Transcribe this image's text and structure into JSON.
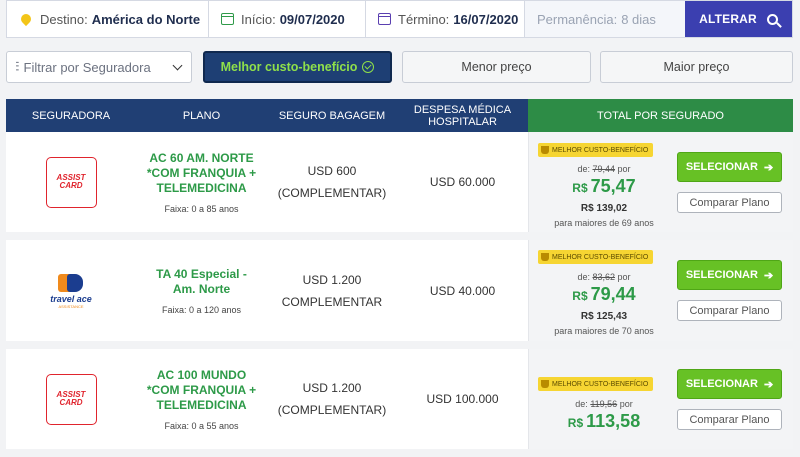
{
  "search": {
    "destino_label": "Destino:",
    "destino_value": "América do Norte",
    "inicio_label": "Início:",
    "inicio_value": "09/07/2020",
    "termino_label": "Término:",
    "termino_value": "16/07/2020",
    "permanencia_label": "Permanência:",
    "permanencia_value": "8 dias",
    "alter_label": "ALTERAR"
  },
  "filters": {
    "seguradora_placeholder": "Filtrar por Seguradora",
    "sort_best": "Melhor custo-benefício",
    "sort_lowest": "Menor preço",
    "sort_highest": "Maior preço"
  },
  "table": {
    "headers": [
      "SEGURADORA",
      "PLANO",
      "SEGURO BAGAGEM",
      "DESPESA MÉDICA HOSPITALAR",
      "TOTAL POR SEGURADO"
    ],
    "rows": [
      {
        "insurer": "ASSIST CARD",
        "plan": "AC 60 AM. NORTE *COM FRANQUIA + TELEMEDICINA",
        "range": "Faixa: 0 a 85 anos",
        "bag_line1": "USD 600",
        "bag_line2": "(COMPLEMENTAR)",
        "medical": "USD 60.000",
        "badge": "MELHOR CUSTO-BENEFÍCIO",
        "old_prefix": "de:",
        "old_price": "79,44",
        "old_suffix": "por",
        "currency": "R$",
        "price": "75,47",
        "senior_price": "R$ 139,02",
        "senior_note": "para maiores de 69 anos",
        "select": "SELECIONAR",
        "compare": "Comparar Plano"
      },
      {
        "insurer": "travel ace",
        "insurer_sub": "ASSISTANCE",
        "plan": "TA 40 Especial - Am. Norte",
        "range": "Faixa: 0 a 120 anos",
        "bag_line1": "USD 1.200",
        "bag_line2": "COMPLEMENTAR",
        "medical": "USD 40.000",
        "badge": "MELHOR CUSTO-BENEFÍCIO",
        "old_prefix": "de:",
        "old_price": "83,62",
        "old_suffix": "por",
        "currency": "R$",
        "price": "79,44",
        "senior_price": "R$ 125,43",
        "senior_note": "para maiores de 70 anos",
        "select": "SELECIONAR",
        "compare": "Comparar Plano"
      },
      {
        "insurer": "ASSIST CARD",
        "plan": "AC 100 MUNDO *COM FRANQUIA + TELEMEDICINA",
        "range": "Faixa: 0 a 55 anos",
        "bag_line1": "USD 1.200",
        "bag_line2": "(COMPLEMENTAR)",
        "medical": "USD 100.000",
        "badge": "MELHOR CUSTO-BENEFÍCIO",
        "old_prefix": "de:",
        "old_price": "119,56",
        "old_suffix": "por",
        "currency": "R$",
        "price": "113,58",
        "select": "SELECIONAR",
        "compare": "Comparar Plano"
      }
    ]
  },
  "colors": {
    "brand_blue": "#203f74",
    "green": "#2d9a48",
    "accent_purple": "#3b3fb0",
    "badge_yellow": "#f6d532"
  }
}
